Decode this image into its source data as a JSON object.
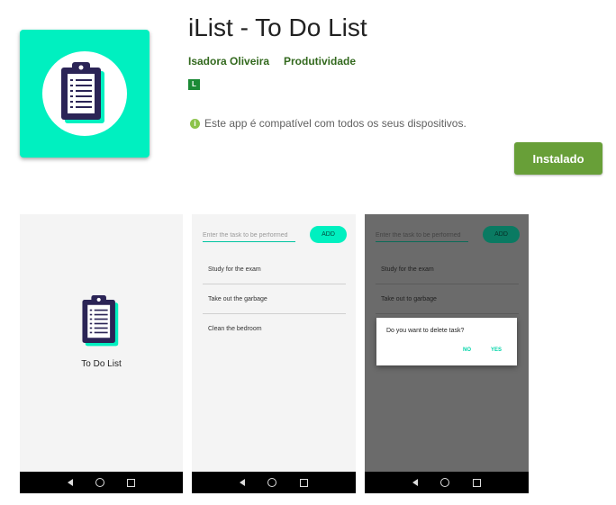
{
  "app": {
    "title": "iList - To Do List",
    "developer": "Isadora Oliveira",
    "category": "Produtividade",
    "content_rating": "L",
    "compatibility_note": "Este app é compatível com todos os seus dispositivos.",
    "install_button": "Instalado",
    "icon": "clipboard-icon",
    "colors": {
      "accent": "#00f0c0",
      "install_button": "#689f38",
      "link": "#33691e",
      "rating_badge": "#1b8a36"
    }
  },
  "screenshots": {
    "splash": {
      "label": "To Do List",
      "icon": "clipboard-icon"
    },
    "list": {
      "input_placeholder": "Enter the task to be performed",
      "add_label": "ADD",
      "tasks": [
        "Study for the exam",
        "Take out the garbage",
        "Clean the bedroom"
      ]
    },
    "dialog_screen": {
      "input_placeholder": "Enter the task to be performed",
      "add_label": "ADD",
      "tasks": [
        "Study for the exam",
        "Take out to garbage"
      ],
      "dialog": {
        "message": "Do you want to delete task?",
        "no": "NO",
        "yes": "YES"
      }
    },
    "navbar_icons": [
      "back-icon",
      "home-icon",
      "recents-icon"
    ]
  }
}
